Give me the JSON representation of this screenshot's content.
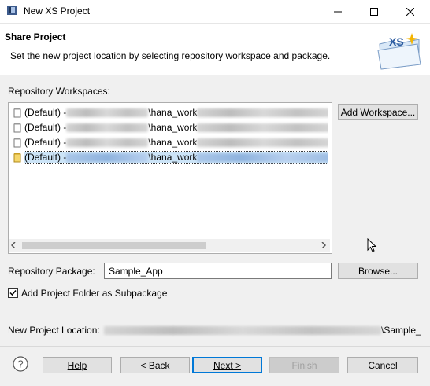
{
  "window": {
    "title": "New XS Project",
    "icons": {
      "app": "app-icon",
      "minimize": "minimize-icon",
      "maximize": "maximize-icon",
      "close": "close-icon"
    }
  },
  "banner": {
    "title": "Share Project",
    "description": "Set the new project location by selecting repository workspace and package.",
    "badge_text": "XS",
    "badge_icon": "xs-folder-icon"
  },
  "workspaces": {
    "label": "Repository Workspaces:",
    "add_button": "Add Workspace...",
    "items": [
      {
        "prefix": "(Default) - ",
        "path_fragment": "\\hana_work",
        "selected": false
      },
      {
        "prefix": "(Default) - ",
        "path_fragment": "\\hana_work",
        "selected": false
      },
      {
        "prefix": "(Default) - ",
        "path_fragment": "\\hana_work",
        "selected": false
      },
      {
        "prefix": "(Default) - ",
        "path_fragment": "\\hana_work",
        "selected": true
      }
    ]
  },
  "package": {
    "label": "Repository Package:",
    "value": "Sample_App",
    "browse_button": "Browse..."
  },
  "subpackage": {
    "label": "Add Project Folder as Subpackage",
    "checked": true
  },
  "location": {
    "label": "New Project Location:",
    "value_suffix": "\\Sample_"
  },
  "footer": {
    "help": "Help",
    "back": "< Back",
    "next": "Next >",
    "finish": "Finish",
    "cancel": "Cancel"
  }
}
